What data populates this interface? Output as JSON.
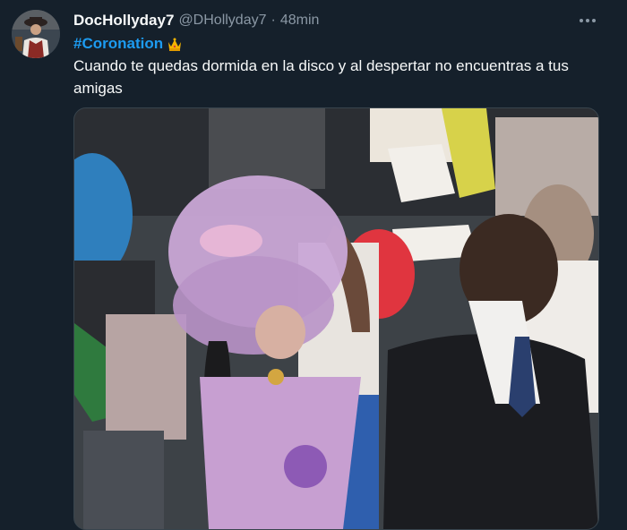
{
  "tweet": {
    "display_name": "DocHollyday7",
    "handle": "@DHollyday7",
    "separator": "·",
    "time": "48min",
    "hashtag": "#Coronation",
    "hashtag_emoji": "crown-emoji",
    "text": "Cuando te quedas dormida en la disco y al despertar no encuentras a tus amigas",
    "more_icon": "more-horizontal-icon",
    "colors": {
      "background": "#15202b",
      "link": "#1d9bf0",
      "secondary_text": "#8b98a5",
      "border": "#38444d"
    }
  }
}
